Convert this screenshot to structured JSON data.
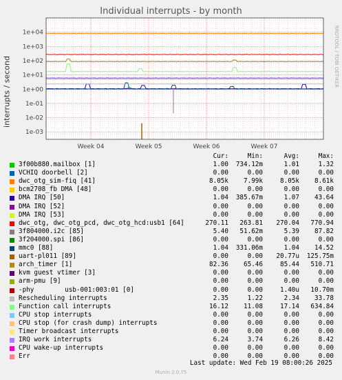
{
  "chart_data": {
    "type": "line",
    "title": "Individual interrupts - by month",
    "ylabel": "interrupts / second",
    "yscale": "log",
    "ylim": [
      0.0003,
      100000
    ],
    "y_tick_labels": [
      "1e+04",
      "1e+03",
      "1e+02",
      "1e+01",
      "1e+00",
      "1e-01",
      "1e-02",
      "1e-03"
    ],
    "y_tick_values": [
      10000,
      1000,
      100,
      10,
      1,
      0.1,
      0.01,
      0.001
    ],
    "x_tick_labels": [
      "Week 04",
      "Week 05",
      "Week 06",
      "Week 07"
    ],
    "grid": true,
    "series": [
      {
        "name": "3f00b880.mailbox [1]",
        "color": "#00cc00",
        "cur": "1.00",
        "min": "734.12m",
        "avg": "1.01",
        "max": "1.32",
        "level": 1.01
      },
      {
        "name": "VCHIQ doorbell [2]",
        "color": "#0066b3",
        "cur": "0.00",
        "min": "0.00",
        "avg": "0.00",
        "max": "0.00",
        "level": 0
      },
      {
        "name": "dwc_otg_sim-fiq [41]",
        "color": "#ff8000",
        "cur": "8.05k",
        "min": "7.99k",
        "avg": "8.05k",
        "max": "8.61k",
        "level": 8050
      },
      {
        "name": "bcm2708_fb DMA [48]",
        "color": "#ffcc00",
        "cur": "0.00",
        "min": "0.00",
        "avg": "0.00",
        "max": "0.00",
        "level": 0
      },
      {
        "name": "DMA IRQ [50]",
        "color": "#330099",
        "cur": "1.04",
        "min": "385.67m",
        "avg": "1.07",
        "max": "43.64",
        "level": 1.07
      },
      {
        "name": "DMA IRQ [52]",
        "color": "#990099",
        "cur": "0.00",
        "min": "0.00",
        "avg": "0.00",
        "max": "0.00",
        "level": 0
      },
      {
        "name": "DMA IRQ [53]",
        "color": "#ccff00",
        "cur": "0.00",
        "min": "0.00",
        "avg": "0.00",
        "max": "0.00",
        "level": 0
      },
      {
        "name": "dwc_otg, dwc_otg_pcd, dwc_otg_hcd:usb1 [64]",
        "color": "#ff0000",
        "cur": "270.11",
        "min": "263.81",
        "avg": "270.04",
        "max": "770.94",
        "level": 270
      },
      {
        "name": "3f804000.i2c [85]",
        "color": "#808080",
        "cur": "5.40",
        "min": "51.62m",
        "avg": "5.39",
        "max": "87.82",
        "level": 5.39
      },
      {
        "name": "3f204000.spi [86]",
        "color": "#008f00",
        "cur": "0.00",
        "min": "0.00",
        "avg": "0.00",
        "max": "0.00",
        "level": 0
      },
      {
        "name": "mmc0 [88]",
        "color": "#00487d",
        "cur": "1.04",
        "min": "331.06m",
        "avg": "1.04",
        "max": "14.52",
        "level": 1.04
      },
      {
        "name": "uart-pl011 [89]",
        "color": "#b35a00",
        "cur": "0.00",
        "min": "0.00",
        "avg": "20.77u",
        "max": "125.75m",
        "level": 0
      },
      {
        "name": "arch_timer [1]",
        "color": "#b38f00",
        "cur": "82.36",
        "min": "65.46",
        "avg": "85.44",
        "max": "510.71",
        "level": 85.4
      },
      {
        "name": "kvm guest vtimer [3]",
        "color": "#6b006b",
        "cur": "0.00",
        "min": "0.00",
        "avg": "0.00",
        "max": "0.00",
        "level": 0
      },
      {
        "name": "arm-pmu [9]",
        "color": "#8fb300",
        "cur": "0.00",
        "min": "0.00",
        "avg": "0.00",
        "max": "0.00",
        "level": 0
      },
      {
        "name": "-phy        usb-001:003:01 [0]",
        "color": "#b30000",
        "cur": "0.00",
        "min": "0.00",
        "avg": "1.40u",
        "max": "10.70m",
        "level": 0
      },
      {
        "name": "Rescheduling interrupts",
        "color": "#bebebe",
        "cur": "2.35",
        "min": "1.22",
        "avg": "2.34",
        "max": "33.78",
        "level": 2.34
      },
      {
        "name": "Function call interrupts",
        "color": "#80ff80",
        "cur": "16.12",
        "min": "11.08",
        "avg": "17.14",
        "max": "634.84",
        "level": 17.1
      },
      {
        "name": "CPU stop interrupts",
        "color": "#80c9ff",
        "cur": "0.00",
        "min": "0.00",
        "avg": "0.00",
        "max": "0.00",
        "level": 0
      },
      {
        "name": "CPU stop (for crash dump) interrupts",
        "color": "#ffc080",
        "cur": "0.00",
        "min": "0.00",
        "avg": "0.00",
        "max": "0.00",
        "level": 0
      },
      {
        "name": "Timer broadcast interrupts",
        "color": "#ffe680",
        "cur": "0.00",
        "min": "0.00",
        "avg": "0.00",
        "max": "0.00",
        "level": 0
      },
      {
        "name": "IRQ work interrupts",
        "color": "#aa80ff",
        "cur": "6.24",
        "min": "3.74",
        "avg": "6.26",
        "max": "8.42",
        "level": 6.26
      },
      {
        "name": "CPU wake-up interrupts",
        "color": "#ee00cc",
        "cur": "0.00",
        "min": "0.00",
        "avg": "0.00",
        "max": "0.00",
        "level": 0
      },
      {
        "name": "Err",
        "color": "#ff8080",
        "cur": "0.00",
        "min": "0.00",
        "avg": "0.00",
        "max": "0.00",
        "level": 0
      }
    ]
  },
  "legend_headers": {
    "cur": "Cur:",
    "min": "Min:",
    "avg": "Avg:",
    "max": "Max:"
  },
  "last_update": "Last update: Wed Feb 19 08:00:26 2025",
  "footer": "Munin 2.0.75",
  "vendor": "RRDTOOL / TOBI OETIKER"
}
